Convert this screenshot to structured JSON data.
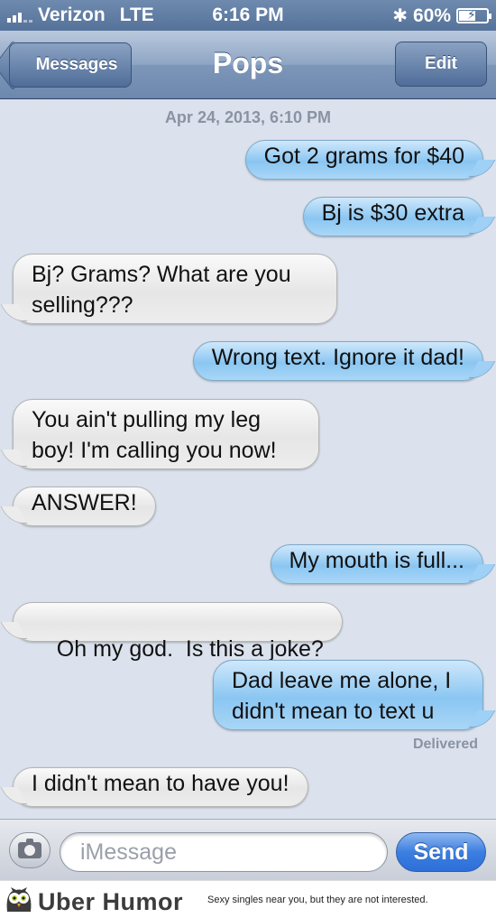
{
  "status_bar": {
    "carrier": "Verizon",
    "network": "LTE",
    "time": "6:16 PM",
    "battery_percent": "60%",
    "battery_level": 0.6,
    "icons": [
      "signal-icon",
      "bluetooth-icon",
      "battery-icon"
    ]
  },
  "nav": {
    "back_label": "Messages",
    "title": "Pops",
    "edit_label": "Edit"
  },
  "conversation": {
    "timestamp": "Apr 24, 2013, 6:10 PM",
    "messages": [
      {
        "direction": "sent",
        "text": "Got 2 grams for $40"
      },
      {
        "direction": "sent",
        "text": "Bj is $30 extra"
      },
      {
        "direction": "received",
        "text": "Bj? Grams? What are you selling???"
      },
      {
        "direction": "sent",
        "text": "Wrong text. Ignore it dad!"
      },
      {
        "direction": "received",
        "text": "You ain't pulling my leg boy! I'm calling you now!"
      },
      {
        "direction": "received",
        "text": "ANSWER!"
      },
      {
        "direction": "sent",
        "text": "My mouth is full..."
      },
      {
        "direction": "received",
        "text": "Oh my god.  Is this a joke?"
      },
      {
        "direction": "sent",
        "text": "Dad leave me alone, I didn't mean to text u"
      },
      {
        "direction": "received",
        "text": "I didn't mean to have you!"
      }
    ],
    "delivered_label": "Delivered"
  },
  "input_bar": {
    "placeholder": "iMessage",
    "send_label": "Send"
  },
  "footer": {
    "brand": "Uber Humor",
    "tagline": "Sexy singles near you, but they are not interested."
  },
  "colors": {
    "sent_bubble": "#8ac6f2",
    "received_bubble": "#e6e6e6",
    "background": "#dbe2ed",
    "nav_bar": "#7d96b9",
    "send_button": "#3c7ee0"
  }
}
